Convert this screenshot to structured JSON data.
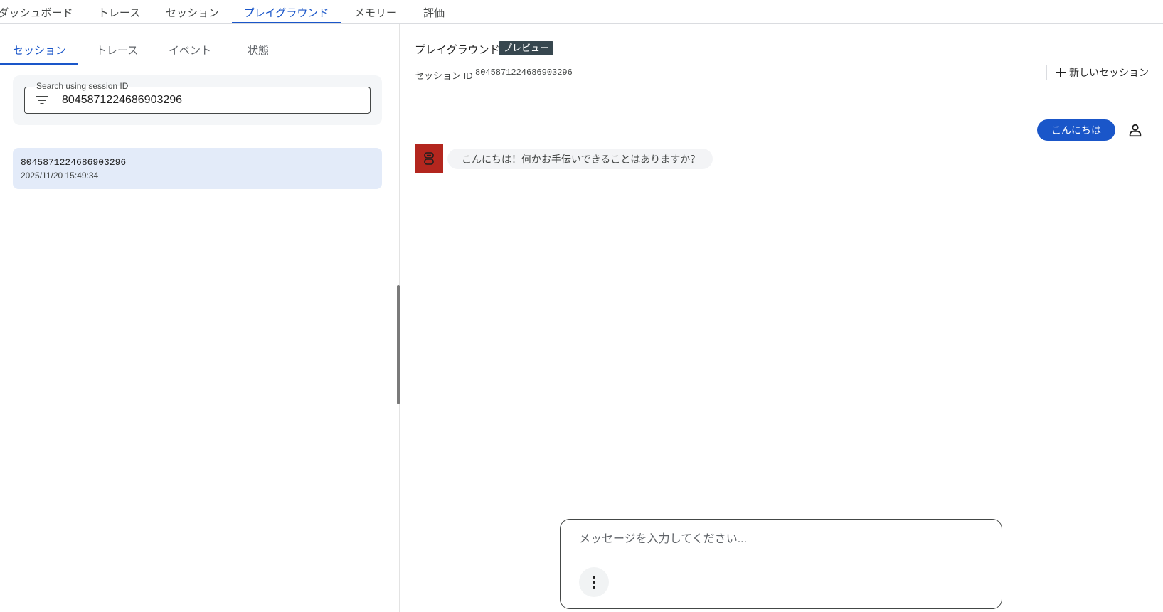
{
  "top_nav": {
    "tabs": [
      {
        "label": "ダッシュボード"
      },
      {
        "label": "トレース"
      },
      {
        "label": "セッション"
      },
      {
        "label": "プレイグラウンド",
        "active": true
      },
      {
        "label": "メモリー"
      },
      {
        "label": "評価"
      }
    ]
  },
  "left_panel": {
    "tabs": [
      {
        "label": "セッション",
        "active": true
      },
      {
        "label": "トレース"
      },
      {
        "label": "イベント"
      },
      {
        "label": "状態"
      }
    ],
    "search": {
      "legend": "Search using session ID",
      "value": "8045871224686903296"
    },
    "sessions": [
      {
        "id": "8045871224686903296",
        "date": "2025/11/20 15:49:34"
      }
    ]
  },
  "playground": {
    "title": "プレイグラウンド",
    "badge": "プレビュー",
    "session_label": "セッション ID",
    "session_id": "8045871224686903296",
    "new_session_label": "新しいセッション",
    "messages": [
      {
        "role": "user",
        "text": "こんにちは"
      },
      {
        "role": "bot",
        "text": "こんにちは！何かお手伝いできることはありますか？"
      }
    ],
    "composer": {
      "placeholder": "メッセージを入力してください..."
    }
  },
  "colors": {
    "accent": "#1a56c9",
    "bot_avatar": "#b3261e",
    "badge_bg": "#37474f",
    "selected_item_bg": "#e3ebf9"
  },
  "icons": {
    "filter": "filter-icon",
    "plus": "plus-icon",
    "user": "person-icon",
    "bot": "robot-icon",
    "more": "more-vert-icon"
  }
}
